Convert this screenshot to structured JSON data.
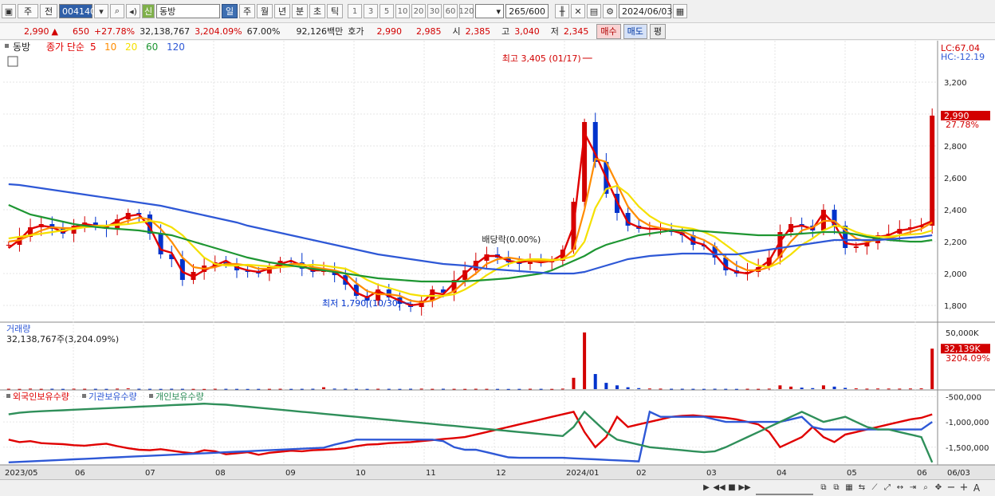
{
  "toolbar": {
    "market_type": "주",
    "scope": "전",
    "code": "004140",
    "badge": "신",
    "name": "동방",
    "periods": [
      "일",
      "주",
      "월",
      "년",
      "분",
      "초",
      "틱"
    ],
    "selected_period": "일",
    "intervals": [
      "1",
      "3",
      "5",
      "10",
      "20",
      "30",
      "60",
      "120"
    ],
    "count": "265",
    "count_max": "/600",
    "date": "2024/06/03"
  },
  "quote": {
    "price": "2,990",
    "change_arrow": "▲",
    "change": "650",
    "change_rate": "+27.78%",
    "volume": "32,138,767",
    "volume_rate": "3,204.09%",
    "strength": "67.00%",
    "amount": "92,126백만",
    "bid_label": "호가",
    "ask_price": "2,990",
    "bid_price": "2,985",
    "open_label": "시",
    "open": "2,385",
    "high_label": "고",
    "high": "3,040",
    "low_label": "저",
    "low": "2,345",
    "buy_label": "매수",
    "sell_label": "매도",
    "avg_label": "평"
  },
  "colors": {
    "up": "#d20000",
    "down": "#0033cc",
    "ma5": "#e00000",
    "ma10": "#ff8c00",
    "ma20": "#f5e000",
    "ma60": "#1e9632",
    "ma120": "#2e58d6",
    "foreign": "#e00000",
    "institution": "#2e58d6",
    "individual": "#2f8f5a"
  },
  "chart_data": [
    {
      "type": "candlestick",
      "title": "동방",
      "legend_prefix": "종가 단순",
      "series": [
        {
          "name": "5",
          "color": "#e00000",
          "values": [
            2160,
            2210,
            2280,
            2300,
            2290,
            2260,
            2290,
            2310,
            2300,
            2290,
            2330,
            2360,
            2370,
            2290,
            2150,
            2130,
            2010,
            1980,
            2020,
            2050,
            2080,
            2040,
            2020,
            2010,
            2030,
            2060,
            2080,
            2050,
            2020,
            2020,
            2010,
            1960,
            1880,
            1850,
            1890,
            1860,
            1830,
            1800,
            1810,
            1880,
            1870,
            1940,
            2000,
            2060,
            2110,
            2110,
            2080,
            2070,
            2080,
            2070,
            2080,
            2120,
            2300,
            2880,
            2750,
            2600,
            2450,
            2320,
            2290,
            2280,
            2280,
            2270,
            2250,
            2200,
            2180,
            2120,
            2040,
            2010,
            2000,
            2030,
            2080,
            2200,
            2290,
            2300,
            2280,
            2380,
            2310,
            2190,
            2180,
            2190,
            2230,
            2240,
            2270,
            2280,
            2300,
            2330
          ]
        },
        {
          "name": "10",
          "color": "#ff8c00",
          "values": [
            2200,
            2210,
            2240,
            2270,
            2290,
            2285,
            2285,
            2295,
            2300,
            2300,
            2310,
            2330,
            2350,
            2340,
            2280,
            2200,
            2100,
            2040,
            2030,
            2040,
            2060,
            2060,
            2050,
            2030,
            2030,
            2040,
            2060,
            2060,
            2040,
            2030,
            2020,
            2000,
            1940,
            1890,
            1870,
            1870,
            1860,
            1830,
            1820,
            1830,
            1860,
            1890,
            1950,
            2000,
            2060,
            2090,
            2100,
            2090,
            2080,
            2080,
            2080,
            2090,
            2150,
            2400,
            2720,
            2700,
            2560,
            2420,
            2340,
            2300,
            2285,
            2275,
            2265,
            2235,
            2210,
            2170,
            2100,
            2050,
            2020,
            2020,
            2040,
            2110,
            2200,
            2270,
            2290,
            2330,
            2330,
            2270,
            2220,
            2200,
            2210,
            2220,
            2240,
            2260,
            2280,
            2320
          ]
        },
        {
          "name": "20",
          "color": "#f5e000",
          "values": [
            2220,
            2230,
            2240,
            2250,
            2260,
            2270,
            2280,
            2290,
            2295,
            2300,
            2305,
            2310,
            2320,
            2330,
            2320,
            2290,
            2240,
            2170,
            2100,
            2060,
            2050,
            2050,
            2055,
            2050,
            2045,
            2040,
            2045,
            2050,
            2055,
            2050,
            2040,
            2030,
            2000,
            1960,
            1930,
            1910,
            1890,
            1870,
            1860,
            1860,
            1860,
            1870,
            1900,
            1940,
            1990,
            2030,
            2060,
            2080,
            2090,
            2090,
            2085,
            2090,
            2110,
            2200,
            2410,
            2530,
            2550,
            2500,
            2420,
            2360,
            2320,
            2300,
            2290,
            2280,
            2260,
            2230,
            2180,
            2130,
            2080,
            2050,
            2040,
            2070,
            2120,
            2180,
            2220,
            2270,
            2300,
            2290,
            2260,
            2240,
            2230,
            2230,
            2240,
            2245,
            2250,
            2270
          ]
        },
        {
          "name": "60",
          "color": "#1e9632",
          "values": [
            2430,
            2400,
            2370,
            2355,
            2340,
            2325,
            2310,
            2300,
            2292,
            2285,
            2280,
            2275,
            2270,
            2260,
            2250,
            2240,
            2220,
            2200,
            2180,
            2160,
            2140,
            2120,
            2100,
            2085,
            2070,
            2060,
            2050,
            2040,
            2030,
            2020,
            2010,
            2000,
            1990,
            1980,
            1970,
            1965,
            1960,
            1955,
            1950,
            1950,
            1950,
            1950,
            1952,
            1955,
            1960,
            1965,
            1970,
            1980,
            1990,
            2000,
            2020,
            2050,
            2080,
            2110,
            2150,
            2180,
            2200,
            2220,
            2240,
            2250,
            2260,
            2270,
            2270,
            2270,
            2265,
            2260,
            2255,
            2250,
            2245,
            2240,
            2240,
            2240,
            2245,
            2250,
            2255,
            2260,
            2260,
            2255,
            2245,
            2230,
            2220,
            2210,
            2205,
            2200,
            2200,
            2210
          ]
        },
        {
          "name": "120",
          "color": "#2e58d6",
          "values": [
            2560,
            2555,
            2545,
            2535,
            2525,
            2515,
            2505,
            2495,
            2485,
            2475,
            2465,
            2455,
            2445,
            2435,
            2425,
            2410,
            2395,
            2380,
            2365,
            2350,
            2335,
            2320,
            2300,
            2285,
            2270,
            2255,
            2240,
            2225,
            2210,
            2195,
            2180,
            2165,
            2150,
            2135,
            2120,
            2110,
            2100,
            2090,
            2080,
            2070,
            2060,
            2055,
            2050,
            2040,
            2030,
            2025,
            2020,
            2015,
            2010,
            2005,
            2000,
            2000,
            2000,
            2010,
            2030,
            2050,
            2070,
            2090,
            2100,
            2110,
            2115,
            2120,
            2125,
            2125,
            2125,
            2120,
            2120,
            2120,
            2130,
            2140,
            2150,
            2160,
            2170,
            2180,
            2190,
            2200,
            2210,
            2210,
            2210,
            2210,
            2210,
            2215,
            2220,
            2225,
            2230,
            2240
          ]
        },
        {
          "name": "close",
          "color": "#222222",
          "values": [
            2180,
            2230,
            2290,
            2310,
            2280,
            2250,
            2300,
            2320,
            2300,
            2280,
            2340,
            2380,
            2370,
            2250,
            2120,
            2090,
            1960,
            2010,
            2050,
            2070,
            2060,
            2020,
            2010,
            2000,
            2040,
            2080,
            2070,
            2030,
            2010,
            2020,
            1990,
            1930,
            1860,
            1830,
            1900,
            1850,
            1810,
            1790,
            1830,
            1900,
            1880,
            1960,
            2020,
            2080,
            2120,
            2100,
            2070,
            2060,
            2090,
            2070,
            2080,
            2150,
            2450,
            2950,
            2700,
            2500,
            2380,
            2300,
            2280,
            2280,
            2280,
            2260,
            2240,
            2180,
            2170,
            2100,
            2020,
            2000,
            2010,
            2040,
            2100,
            2260,
            2310,
            2300,
            2270,
            2400,
            2300,
            2160,
            2170,
            2190,
            2240,
            2250,
            2280,
            2290,
            2300,
            2990
          ]
        }
      ],
      "x_ticks": [
        "2023/05",
        "06",
        "07",
        "08",
        "09",
        "10",
        "11",
        "12",
        "2024/01",
        "02",
        "03",
        "04",
        "05",
        "06",
        "06/03"
      ],
      "y_ticks": [
        1800,
        2000,
        2200,
        2400,
        2600,
        2800,
        3000,
        3200
      ],
      "ylim": [
        1700,
        3450
      ],
      "lc_label": "LC:67.04",
      "hc_label": "HC:-12.19",
      "last_price_label": "2,990",
      "last_change_label": "27.78%",
      "annotations": {
        "high": "최고 3,405 (01/17)",
        "low": "최저 1,790 (10/30)",
        "dividend": "배당락(0.00%)"
      }
    },
    {
      "type": "bar",
      "title": "거래량",
      "value_label": "32,138,767주(3,204.09%)",
      "y_ticks": [
        "50,000K"
      ],
      "ylim": [
        0,
        50000
      ],
      "last_label": "32,139K",
      "last_rate": "3204.09%",
      "values": [
        300,
        200,
        400,
        250,
        300,
        200,
        350,
        300,
        250,
        200,
        400,
        600,
        300,
        250,
        200,
        300,
        250,
        200,
        150,
        300,
        250,
        200,
        150,
        200,
        250,
        300,
        200,
        250,
        300,
        1500,
        400,
        300,
        250,
        200,
        300,
        250,
        200,
        300,
        400,
        250,
        300,
        250,
        200,
        300,
        250,
        200,
        150,
        200,
        300,
        250,
        200,
        400,
        9000,
        45000,
        12000,
        5000,
        3000,
        1500,
        800,
        500,
        400,
        300,
        300,
        250,
        200,
        300,
        250,
        200,
        300,
        250,
        400,
        3000,
        2000,
        1200,
        800,
        3000,
        2000,
        1000,
        600,
        400,
        500,
        450,
        400,
        500,
        600,
        32139
      ]
    },
    {
      "type": "line",
      "title": "수급",
      "series": [
        {
          "name": "외국인보유수량",
          "color": "#e00000",
          "values": [
            -1350000,
            -1400000,
            -1380000,
            -1420000,
            -1430000,
            -1440000,
            -1460000,
            -1470000,
            -1450000,
            -1430000,
            -1480000,
            -1520000,
            -1550000,
            -1560000,
            -1540000,
            -1570000,
            -1600000,
            -1620000,
            -1560000,
            -1580000,
            -1640000,
            -1620000,
            -1600000,
            -1650000,
            -1610000,
            -1590000,
            -1570000,
            -1580000,
            -1560000,
            -1550000,
            -1540000,
            -1520000,
            -1480000,
            -1450000,
            -1440000,
            -1420000,
            -1410000,
            -1400000,
            -1380000,
            -1360000,
            -1340000,
            -1320000,
            -1300000,
            -1250000,
            -1200000,
            -1150000,
            -1100000,
            -1050000,
            -1000000,
            -950000,
            -900000,
            -850000,
            -800000,
            -1200000,
            -1500000,
            -1300000,
            -900000,
            -1100000,
            -1050000,
            -1000000,
            -950000,
            -900000,
            -880000,
            -870000,
            -890000,
            -900000,
            -920000,
            -950000,
            -1000000,
            -1050000,
            -1200000,
            -1500000,
            -1400000,
            -1300000,
            -1100000,
            -1300000,
            -1400000,
            -1250000,
            -1200000,
            -1150000,
            -1100000,
            -1050000,
            -1000000,
            -950000,
            -920000,
            -850000
          ]
        },
        {
          "name": "기관보유수량",
          "color": "#2e58d6",
          "values": [
            -1800000,
            -1790000,
            -1780000,
            -1770000,
            -1760000,
            -1750000,
            -1740000,
            -1730000,
            -1720000,
            -1710000,
            -1700000,
            -1690000,
            -1680000,
            -1670000,
            -1660000,
            -1650000,
            -1640000,
            -1630000,
            -1620000,
            -1610000,
            -1600000,
            -1590000,
            -1580000,
            -1570000,
            -1560000,
            -1550000,
            -1540000,
            -1530000,
            -1520000,
            -1510000,
            -1450000,
            -1400000,
            -1350000,
            -1350000,
            -1350000,
            -1350000,
            -1350000,
            -1350000,
            -1350000,
            -1350000,
            -1380000,
            -1500000,
            -1550000,
            -1550000,
            -1600000,
            -1650000,
            -1700000,
            -1710000,
            -1710000,
            -1710000,
            -1710000,
            -1710000,
            -1720000,
            -1730000,
            -1740000,
            -1750000,
            -1760000,
            -1770000,
            -1780000,
            -800000,
            -900000,
            -900000,
            -900000,
            -900000,
            -900000,
            -950000,
            -1000000,
            -1000000,
            -1000000,
            -1000000,
            -1000000,
            -1000000,
            -950000,
            -900000,
            -1100000,
            -1150000,
            -1150000,
            -1150000,
            -1150000,
            -1150000,
            -1150000,
            -1150000,
            -1150000,
            -1150000,
            -1150000,
            -1000000
          ]
        },
        {
          "name": "개인보유수량",
          "color": "#2f8f5a",
          "values": [
            -850000,
            -820000,
            -800000,
            -790000,
            -780000,
            -770000,
            -760000,
            -750000,
            -740000,
            -730000,
            -720000,
            -710000,
            -700000,
            -690000,
            -680000,
            -670000,
            -660000,
            -650000,
            -640000,
            -650000,
            -660000,
            -680000,
            -700000,
            -720000,
            -740000,
            -760000,
            -780000,
            -800000,
            -820000,
            -840000,
            -860000,
            -880000,
            -900000,
            -920000,
            -940000,
            -960000,
            -980000,
            -1000000,
            -1020000,
            -1040000,
            -1060000,
            -1080000,
            -1100000,
            -1120000,
            -1140000,
            -1160000,
            -1180000,
            -1200000,
            -1220000,
            -1240000,
            -1260000,
            -1280000,
            -1100000,
            -800000,
            -1000000,
            -1200000,
            -1350000,
            -1400000,
            -1450000,
            -1500000,
            -1520000,
            -1540000,
            -1560000,
            -1580000,
            -1600000,
            -1580000,
            -1500000,
            -1400000,
            -1300000,
            -1200000,
            -1100000,
            -1000000,
            -900000,
            -800000,
            -900000,
            -1000000,
            -950000,
            -900000,
            -1000000,
            -1100000,
            -1150000,
            -1150000,
            -1200000,
            -1250000,
            -1300000,
            -1800000
          ]
        }
      ],
      "y_ticks": [
        "-500,000",
        "-1,000,000",
        "-1,500,000"
      ],
      "ylim": [
        -1850000,
        -400000
      ]
    }
  ],
  "bottom": {
    "zoom_out": "−",
    "zoom_in": "+",
    "text_tool": "A"
  }
}
